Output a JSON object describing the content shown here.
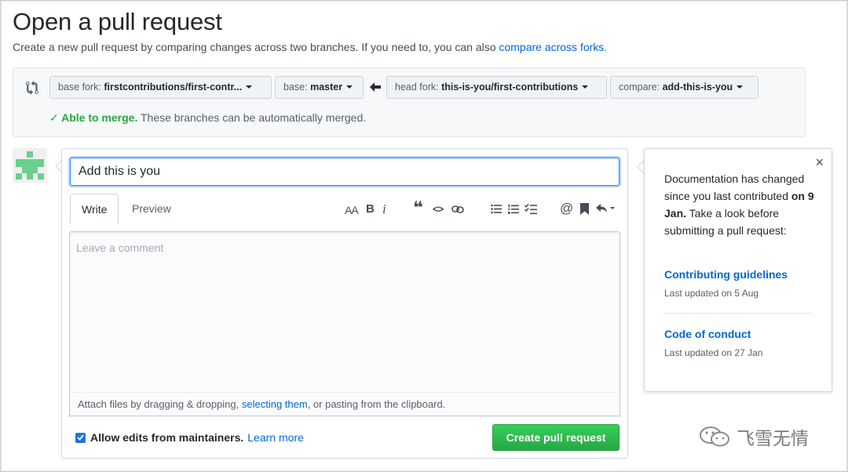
{
  "page": {
    "title": "Open a pull request",
    "subtitle_text": "Create a new pull request by comparing changes across two branches. If you need to, you can also",
    "subtitle_link": "compare across forks."
  },
  "range": {
    "base_fork_label": "base fork:",
    "base_fork_value": "firstcontributions/first-contr...",
    "base_label": "base:",
    "base_value": "master",
    "head_fork_label": "head fork:",
    "head_fork_value": "this-is-you/first-contributions",
    "compare_label": "compare:",
    "compare_value": "add-this-is-you",
    "merge_ok": "✓ Able to merge.",
    "merge_msg": "These branches can be automatically merged."
  },
  "form": {
    "title_value": "Add this is you",
    "tabs": [
      {
        "label": "Write"
      },
      {
        "label": "Preview"
      }
    ],
    "comment_placeholder": "Leave a comment",
    "attach_prefix": "Attach files by dragging & dropping,",
    "attach_link": "selecting them",
    "attach_suffix": ", or pasting from the clipboard.",
    "allow_edits_label": "Allow edits from maintainers.",
    "learn_more": "Learn more",
    "submit_label": "Create pull request",
    "allow_edits_checked": true
  },
  "sidebar": {
    "msg_part1": "Documentation has changed since you last contributed",
    "msg_date": "on 9 Jan.",
    "msg_part2": "Take a look before submitting a pull request:",
    "close_glyph": "×",
    "links": [
      {
        "title": "Contributing guidelines",
        "updated": "Last updated on 5 Aug"
      },
      {
        "title": "Code of conduct",
        "updated": "Last updated on 27 Jan"
      }
    ]
  },
  "toolbar": {
    "heading": "AA",
    "bold": "B",
    "italic": "i",
    "quote": "❝",
    "code": "<>",
    "mention": "@"
  },
  "watermark": {
    "text": "飞雪无情"
  },
  "colors": {
    "link": "#0366d6",
    "success": "#28a745",
    "avatar": "#6ad08c"
  }
}
